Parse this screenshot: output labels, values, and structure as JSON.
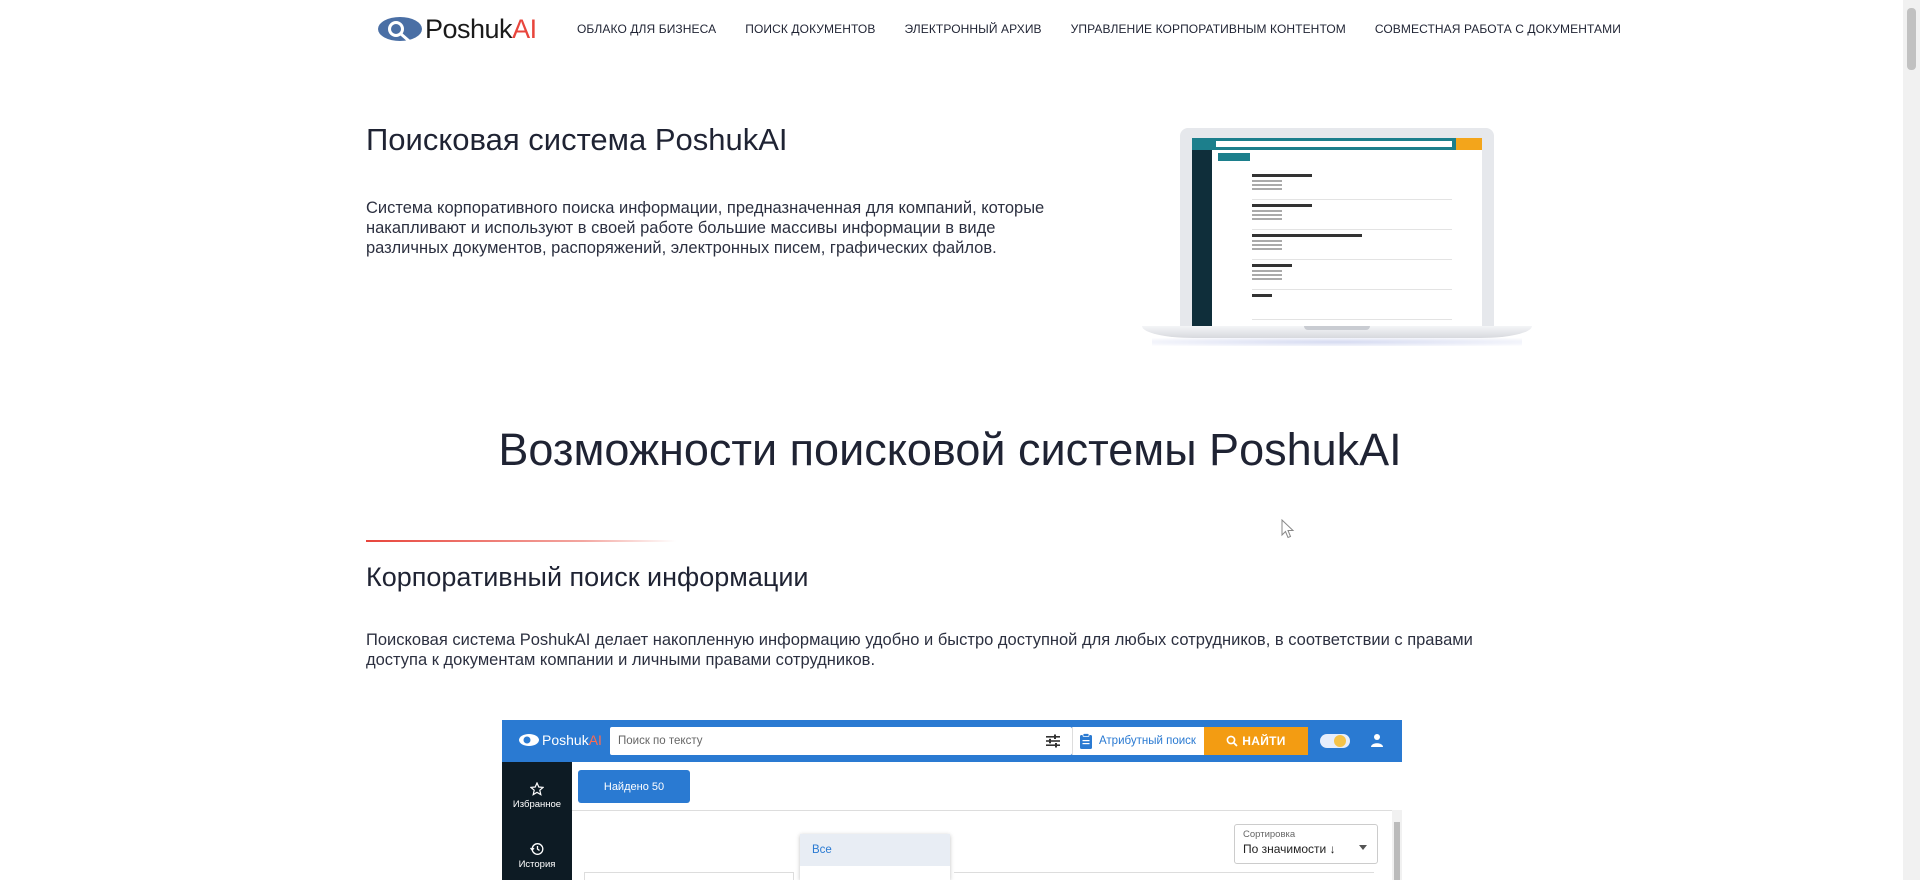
{
  "header": {
    "logo": {
      "main": "Poshuk",
      "accent": "AI"
    },
    "nav": [
      "ОБЛАКО ДЛЯ БИЗНЕСА",
      "ПОИСК ДОКУМЕНТОВ",
      "ЭЛЕКТРОННЫЙ АРХИВ",
      "УПРАВЛЕНИЕ КОРПОРАТИВНЫМ КОНТЕНТОМ",
      "СОВМЕСТНАЯ РАБОТА С ДОКУМЕНТАМИ"
    ]
  },
  "hero": {
    "title": "Поисковая система PoshukAI",
    "description": "Система корпоративного поиска информации, предназначенная для компаний, которые накапливают и используют в своей работе большие массивы информации в виде различных документов, распоряжений, электронных писем, графических файлов."
  },
  "features": {
    "title": "Возможности поисковой системы PoshukAI",
    "corporate": {
      "title": "Корпоративный поиск информации",
      "description": "Поисковая система PoshukAI делает накопленную информацию удобно и быстро доступной для любых сотрудников, в соответствии с правами доступа к документам компании и личными правами сотрудников."
    }
  },
  "app_preview": {
    "logo": {
      "main": "Poshuk",
      "accent": "AI"
    },
    "search_placeholder": "Поиск по тексту",
    "attr_search": "Атрибутный поиск",
    "find_button": "НАЙТИ",
    "sidebar": [
      {
        "label": "Избранное",
        "icon": "star-icon"
      },
      {
        "label": "История",
        "icon": "history-icon"
      }
    ],
    "found": "Найдено 50",
    "dropdown_option": "Все",
    "sort": {
      "label": "Сортировка",
      "value": "По значимости ↓"
    }
  },
  "colors": {
    "brand_red": "#e8453c",
    "app_blue": "#2a7ad2",
    "app_orange": "#f39c12",
    "text_dark": "#1f2333"
  }
}
